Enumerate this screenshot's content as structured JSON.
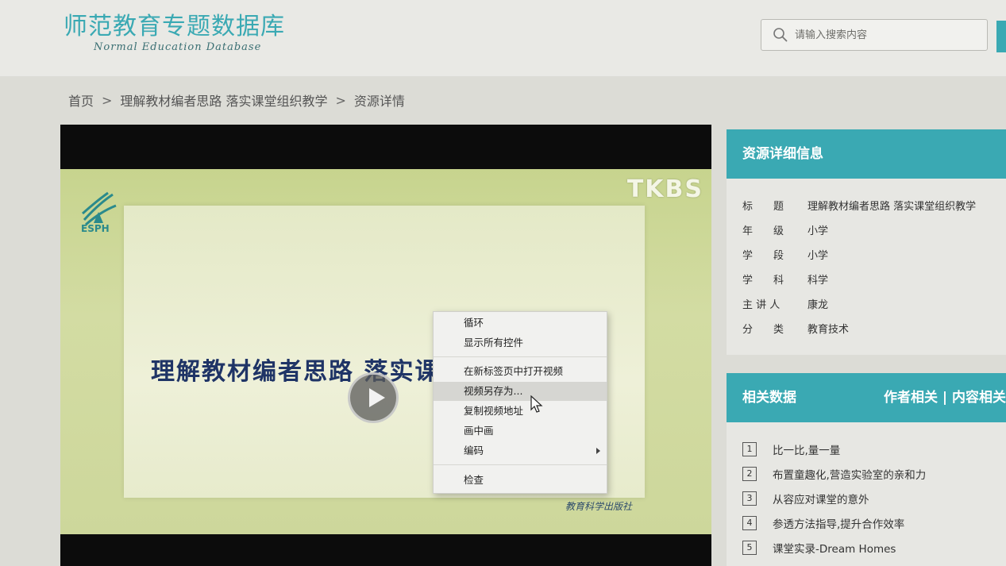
{
  "header": {
    "title": "师范教育专题数据库",
    "subtitle": "Normal Education Database",
    "search_placeholder": "请输入搜索内容"
  },
  "breadcrumb": {
    "home": "首页",
    "sep": ">",
    "course": "理解教材编者思路 落实课堂组织教学",
    "current": "资源详情"
  },
  "video": {
    "brand": "TKBS",
    "logo_text": "ESPH",
    "slide_title": "理解教材编者思路  落实课堂组织教学",
    "publisher": "教育科学出版社"
  },
  "context_menu": {
    "items": [
      "循环",
      "显示所有控件",
      "在新标签页中打开视频",
      "视频另存为...",
      "复制视频地址",
      "画中画",
      "编码",
      "检查"
    ],
    "hovered_index": 3
  },
  "resource_info": {
    "heading": "资源详细信息",
    "rows": [
      {
        "label": "标　　题",
        "value": "理解教材编者思路 落实课堂组织教学"
      },
      {
        "label": "年　　级",
        "value": "小学"
      },
      {
        "label": "学　　段",
        "value": "小学"
      },
      {
        "label": "学　　科",
        "value": "科学"
      },
      {
        "label": "主 讲 人",
        "value": "康龙"
      },
      {
        "label": "分　　类",
        "value": "教育技术"
      }
    ]
  },
  "related": {
    "heading": "相关数据",
    "tabs": "作者相关 | 内容相关",
    "items": [
      {
        "num": "1",
        "title": "比一比,量一量"
      },
      {
        "num": "2",
        "title": "布置童趣化,营造实验室的亲和力"
      },
      {
        "num": "3",
        "title": "从容应对课堂的意外"
      },
      {
        "num": "4",
        "title": "参透方法指导,提升合作效率"
      },
      {
        "num": "5",
        "title": "课堂实录-Dream Homes"
      }
    ]
  },
  "colors": {
    "accent": "#3aa9b3",
    "title_blue": "#1f3466"
  }
}
